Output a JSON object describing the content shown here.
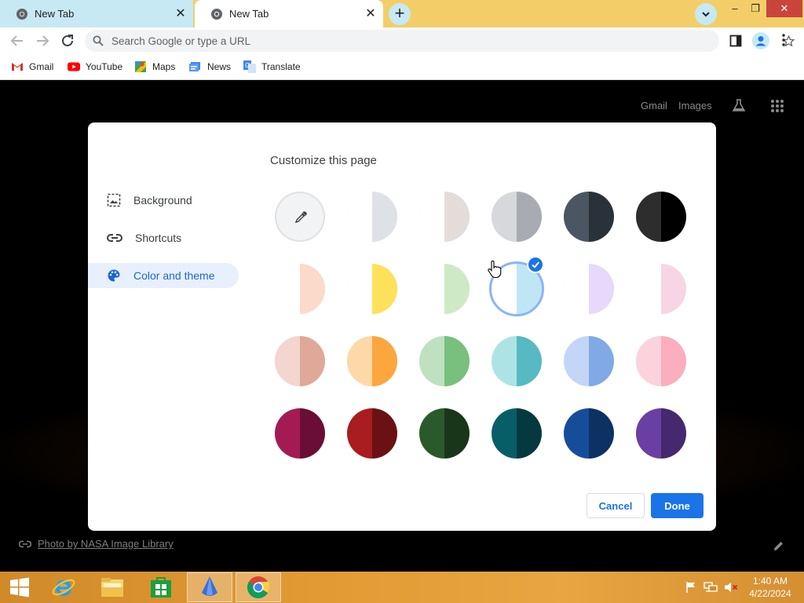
{
  "tabs": [
    {
      "title": "New Tab",
      "active": false
    },
    {
      "title": "New Tab",
      "active": true
    }
  ],
  "toolbar": {
    "omnibox_placeholder": "Search Google or type a URL"
  },
  "bookmarks": [
    {
      "label": "Gmail",
      "icon": "gmail-icon"
    },
    {
      "label": "YouTube",
      "icon": "youtube-icon"
    },
    {
      "label": "Maps",
      "icon": "maps-icon"
    },
    {
      "label": "News",
      "icon": "news-icon"
    },
    {
      "label": "Translate",
      "icon": "translate-icon"
    }
  ],
  "ntp": {
    "gmail_link": "Gmail",
    "images_link": "Images",
    "attribution": "Photo by NASA Image Library"
  },
  "dialog": {
    "title": "Customize this page",
    "sidebar": [
      {
        "label": "Background",
        "icon": "image-icon",
        "selected": false
      },
      {
        "label": "Shortcuts",
        "icon": "link-icon",
        "selected": false
      },
      {
        "label": "Color and theme",
        "icon": "palette-icon",
        "selected": true
      }
    ],
    "swatches": [
      [
        [
          "custom",
          "custom"
        ],
        [
          "#ffffff",
          "#dee1e6"
        ],
        [
          "#ffffff",
          "#e3dcd9"
        ],
        [
          "#d7d8dc",
          "#a9abb3"
        ],
        [
          "#4a5661",
          "#2a3239"
        ],
        [
          "#2d2d2d",
          "#000000"
        ]
      ],
      [
        [
          "#ffffff",
          "#fcdac9"
        ],
        [
          "#ffffff",
          "#fde15a"
        ],
        [
          "#ffffff",
          "#cdeac4"
        ],
        [
          "#ffffff",
          "#bfe6f5"
        ],
        [
          "#ffffff",
          "#e6d9fb"
        ],
        [
          "#ffffff",
          "#f8d5e4"
        ]
      ],
      [
        [
          "#f2d6cf",
          "#e0a898"
        ],
        [
          "#fdd9a8",
          "#fca63e"
        ],
        [
          "#bfe1c0",
          "#79bf7d"
        ],
        [
          "#aee3e6",
          "#57b9c2"
        ],
        [
          "#c3d6f7",
          "#81a9e6"
        ],
        [
          "#fcd3dd",
          "#fbaebd"
        ]
      ],
      [
        [
          "#a41b53",
          "#6a0e35"
        ],
        [
          "#a91c1f",
          "#6b1113"
        ],
        [
          "#2a5a2c",
          "#1a361a"
        ],
        [
          "#085e67",
          "#043a3f"
        ],
        [
          "#164d9b",
          "#0c3264"
        ],
        [
          "#6a3fa3",
          "#46286e"
        ]
      ]
    ],
    "selected_swatch": {
      "row": 1,
      "col": 3
    },
    "cancel_label": "Cancel",
    "done_label": "Done"
  },
  "taskbar": {
    "items": [
      "start-icon",
      "ie-icon",
      "file-explorer-icon",
      "store-icon",
      "app-icon",
      "chrome-icon"
    ],
    "active_item": "chrome-icon",
    "time": "1:40 AM",
    "date": "4/22/2024"
  },
  "colors": {
    "titlebar": "#f3ce68",
    "inactive_tab": "#c6e9f3",
    "accent": "#1a73e8",
    "close_button": "#c9453b"
  }
}
